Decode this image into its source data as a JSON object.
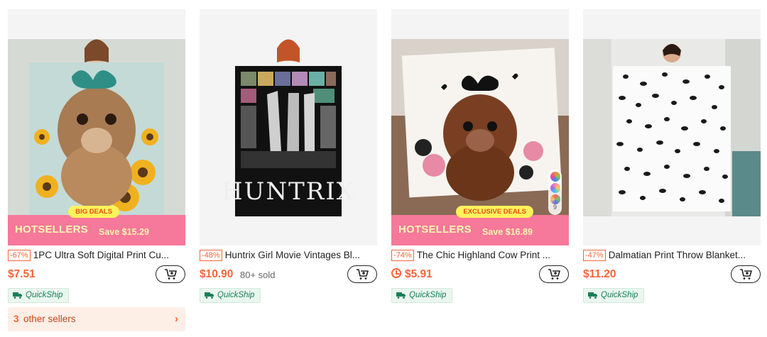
{
  "products": [
    {
      "discount": "-67%",
      "title": "1PC Ultra Soft Digital Print Cu...",
      "price": "$7.51",
      "sold": "",
      "shipping": "QuickShip",
      "banner": {
        "label": "HOTSELLERS",
        "tag": "BIG DEALS",
        "save": "Save $15.29"
      },
      "other_sellers": {
        "count": "3",
        "label": "other sellers"
      }
    },
    {
      "discount": "-48%",
      "title": "Huntrix Girl Movie Vintages Bl...",
      "price": "$10.90",
      "sold": "80+ sold",
      "shipping": "QuickShip",
      "image_text": "HUNTRIX"
    },
    {
      "discount": "-74%",
      "title": "The Chic Highland Cow Print ...",
      "price": "$5.91",
      "sold": "",
      "shipping": "QuickShip",
      "banner": {
        "label": "HOTSELLERS",
        "tag": "EXCLUSIVE DEALS",
        "save": "Save $16.89"
      },
      "color_count": "9",
      "flash_icon": "clock-icon"
    },
    {
      "discount": "-47%",
      "title": "Dalmatian Print Throw Blanket...",
      "price": "$11.20",
      "sold": "",
      "shipping": "QuickShip"
    }
  ],
  "colors": {
    "accent": "#fa6338",
    "banner": "#f6789a",
    "quickship": "#198055"
  },
  "icons": {
    "cart": "add-to-cart-icon",
    "truck": "truck-icon",
    "chevron": "chevron-right-icon"
  }
}
